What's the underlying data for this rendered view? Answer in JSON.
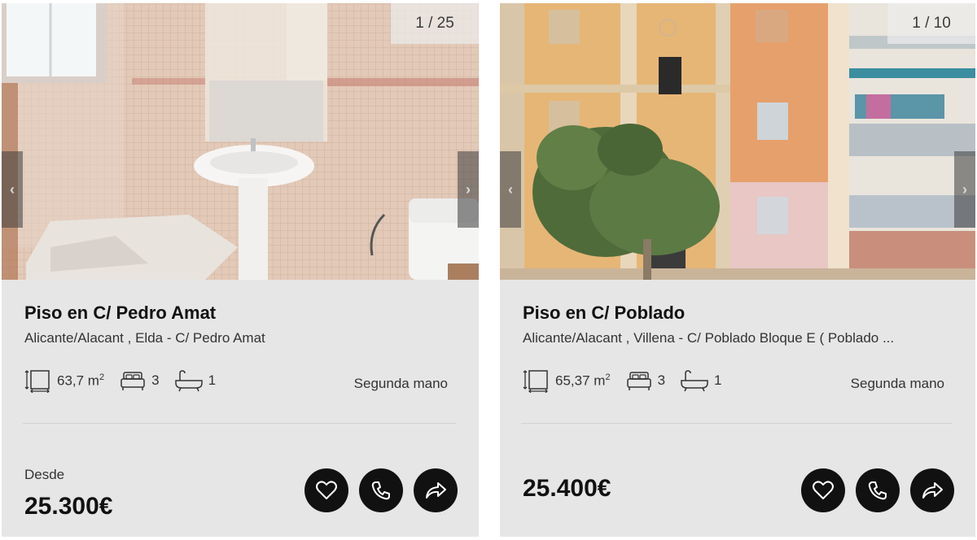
{
  "listings": [
    {
      "photo_counter": "1 / 25",
      "title": "Piso en C/ Pedro Amat",
      "address": "Alicante/Alacant , Elda - C/ Pedro Amat",
      "area": "63,7 m",
      "area_unit_sup": "2",
      "bedrooms": "3",
      "bathrooms": "1",
      "condition": "Segunda mano",
      "price_prefix": "Desde",
      "price": "25.300€"
    },
    {
      "photo_counter": "1 / 10",
      "title": "Piso en C/ Poblado",
      "address": "Alicante/Alacant , Villena - C/ Poblado Bloque E ( Poblado ...",
      "area": "65,37 m",
      "area_unit_sup": "2",
      "bedrooms": "3",
      "bathrooms": "1",
      "condition": "Segunda mano",
      "price": "25.400€"
    }
  ],
  "icons": {
    "prev": "chevron-left-icon",
    "next": "chevron-right-icon",
    "area": "area-icon",
    "bed": "bed-icon",
    "bath": "bathtub-icon",
    "favorite": "heart-icon",
    "call": "phone-icon",
    "share": "share-icon"
  },
  "colors": {
    "card_bg": "#e6e6e6",
    "button_bg": "#111111"
  }
}
